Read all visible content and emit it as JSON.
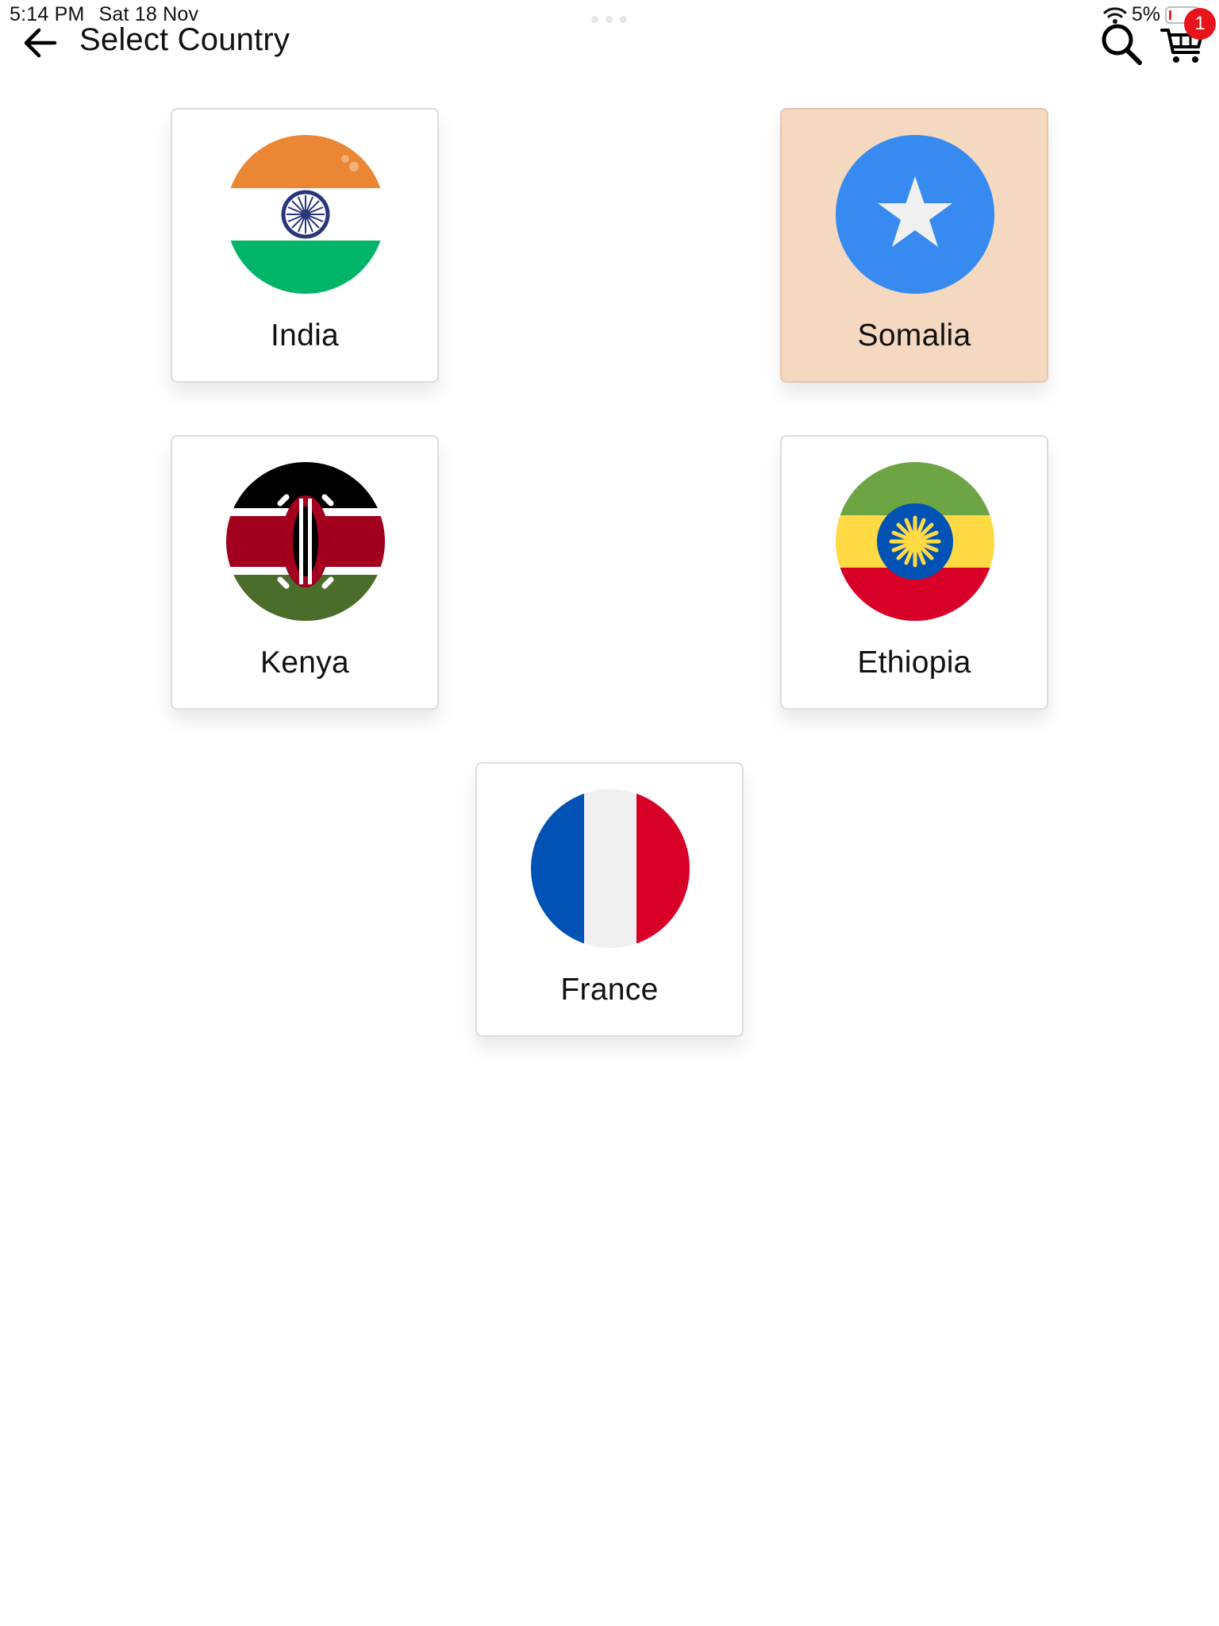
{
  "status_bar": {
    "time": "5:14 PM",
    "date": "Sat 18 Nov",
    "battery": "5%"
  },
  "header": {
    "title": "Select Country",
    "cart_count": "1"
  },
  "countries": [
    {
      "name": "India",
      "selected": false
    },
    {
      "name": "Somalia",
      "selected": true
    },
    {
      "name": "Kenya",
      "selected": false
    },
    {
      "name": "Ethiopia",
      "selected": false
    },
    {
      "name": "France",
      "selected": false
    }
  ],
  "colors": {
    "selected_card_bg": "#f4d8bf",
    "badge": "#e8141b"
  },
  "icons": {
    "back": "arrow-left-icon",
    "search": "search-icon",
    "cart": "cart-icon",
    "wifi": "wifi-icon",
    "battery": "battery-icon"
  }
}
